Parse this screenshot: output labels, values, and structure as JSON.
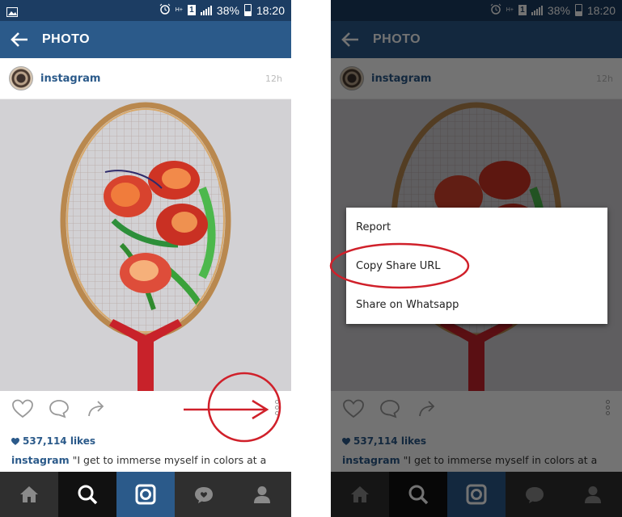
{
  "status_bar": {
    "battery": "38%",
    "time": "18:20",
    "network": "H+",
    "sim": "1"
  },
  "app_bar": {
    "title": "PHOTO"
  },
  "post": {
    "username": "instagram",
    "time_ago": "12h",
    "likes": "537,114 likes",
    "caption_user": "instagram",
    "caption_text": "\"I get to immerse myself in colors at a"
  },
  "menu": {
    "items": [
      "Report",
      "Copy Share URL",
      "Share on Whatsapp"
    ]
  },
  "colors": {
    "status_bar": "#1c3d63",
    "app_bar": "#2b5a8a",
    "link_blue": "#2b5a8a",
    "nav_bg": "#2f2f2f",
    "annotation_red": "#d0202a"
  },
  "icons": {
    "back": "arrow-left-icon",
    "like": "heart-icon",
    "comment": "comment-bubble-icon",
    "share": "share-arrow-icon",
    "more": "vertical-ellipsis-icon",
    "nav": [
      "home-icon",
      "search-icon",
      "camera-icon",
      "activity-heart-icon",
      "profile-icon"
    ]
  }
}
